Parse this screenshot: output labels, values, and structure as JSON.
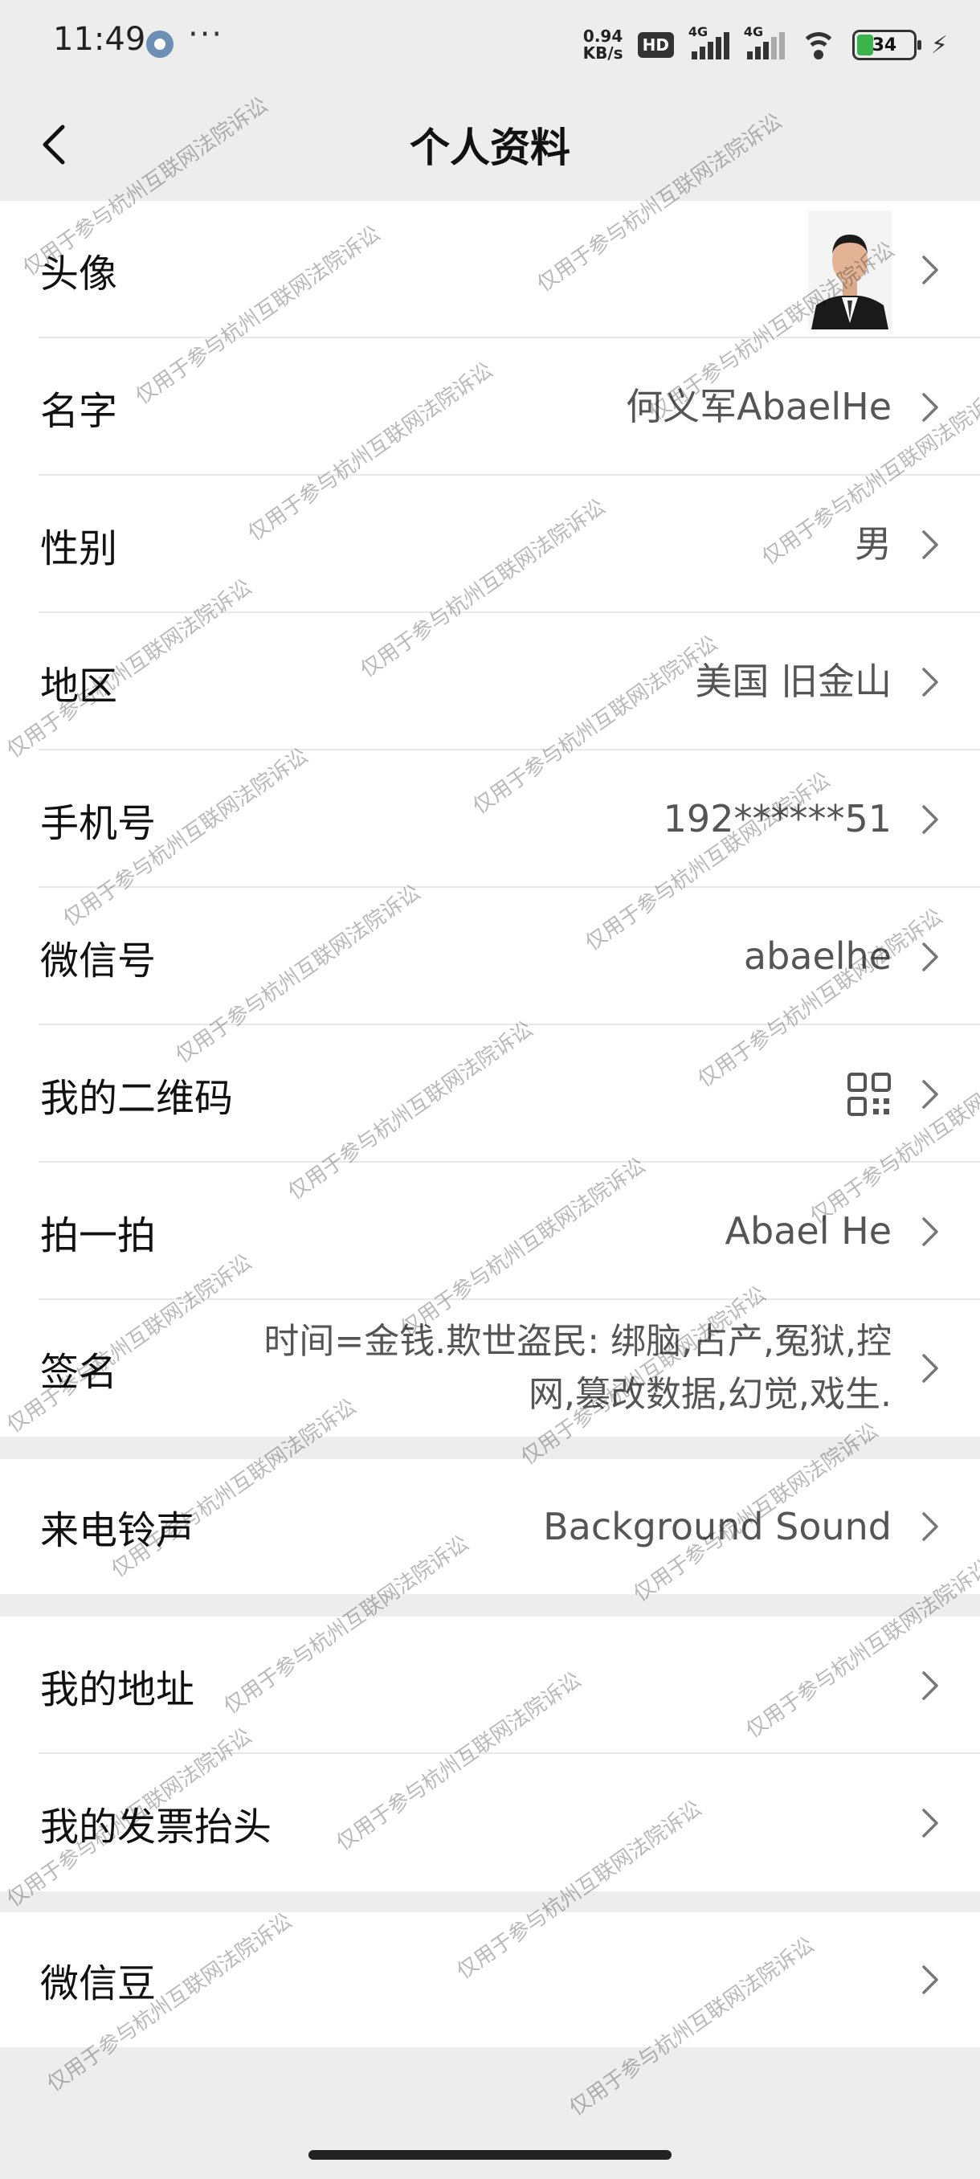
{
  "status_bar": {
    "time": "11:49",
    "more": "···",
    "net_speed_value": "0.94",
    "net_speed_unit": "KB/s",
    "hd_badge": "HD",
    "signal_tag_1": "4G",
    "signal_tag_2": "4G",
    "battery_level": "34"
  },
  "nav": {
    "title": "个人资料"
  },
  "profile": {
    "avatar": {
      "label": "头像"
    },
    "name": {
      "label": "名字",
      "value": "何义军AbaelHe"
    },
    "gender": {
      "label": "性别",
      "value": "男"
    },
    "region": {
      "label": "地区",
      "value": "美国 旧金山"
    },
    "phone": {
      "label": "手机号",
      "value": "192******51"
    },
    "wechat_id": {
      "label": "微信号",
      "value": "abaelhe"
    },
    "qr_code": {
      "label": "我的二维码",
      "icon": "qr-code-icon"
    },
    "pat": {
      "label": "拍一拍",
      "value": "Abael He"
    },
    "signature": {
      "label": "签名",
      "value_line1": "时间=金钱.欺世盗民: 绑脑,占产,冤狱,控",
      "value_line2": "网,篡改数据,幻觉,戏生."
    }
  },
  "ringtone": {
    "label": "来电铃声",
    "value": "Background Sound"
  },
  "other": {
    "address": {
      "label": "我的地址"
    },
    "invoice": {
      "label": "我的发票抬头"
    }
  },
  "beans": {
    "label": "微信豆"
  },
  "watermark_text": "仅用于参与杭州互联网法院诉讼",
  "colors": {
    "page_bg": "#ededed",
    "row_bg": "#ffffff",
    "value_text": "#555555",
    "battery_fill": "#3bb54a"
  }
}
